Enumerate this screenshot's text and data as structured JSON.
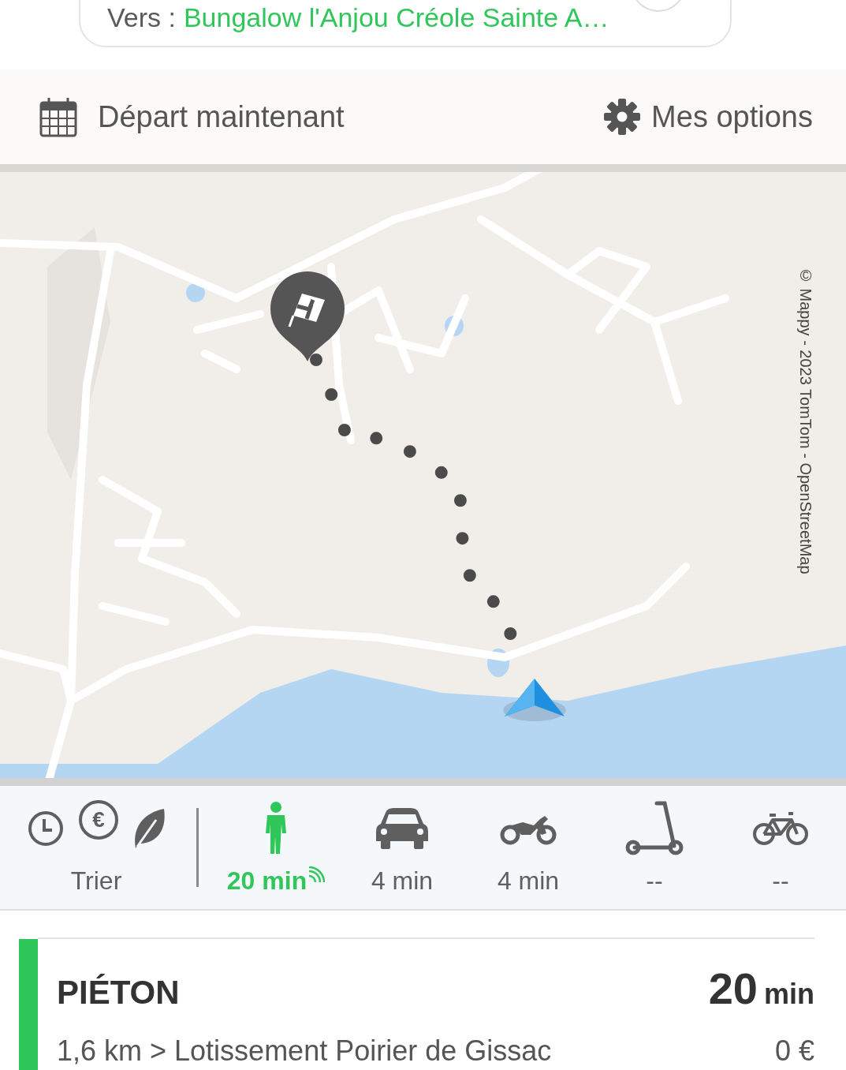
{
  "destination": {
    "label": "Vers :",
    "value": "Bungalow l'Anjou Créole Sainte A…"
  },
  "departure": {
    "label": "Départ maintenant"
  },
  "options": {
    "label": "Mes options"
  },
  "map": {
    "kind": "picture",
    "attribution": "© Mappy - 2023 TomTom - OpenStreetMap"
  },
  "sort": {
    "label": "Trier",
    "options": [
      {
        "kind": "time"
      },
      {
        "kind": "price",
        "symbol": "€"
      },
      {
        "kind": "eco"
      }
    ]
  },
  "modes": [
    {
      "kind": "walk",
      "time": "20 min",
      "selected": true,
      "live": true
    },
    {
      "kind": "car",
      "time": "4 min",
      "selected": false,
      "live": false
    },
    {
      "kind": "moto",
      "time": "4 min",
      "selected": false,
      "live": false
    },
    {
      "kind": "scooter",
      "time": "--",
      "selected": false,
      "live": false
    },
    {
      "kind": "bike",
      "time": "--",
      "selected": false,
      "live": false
    }
  ],
  "result": {
    "mode": "PIÉTON",
    "duration": "20",
    "unit": "min",
    "details": "1,6 km > Lotissement Poirier de Gissac",
    "price": "0 €"
  }
}
